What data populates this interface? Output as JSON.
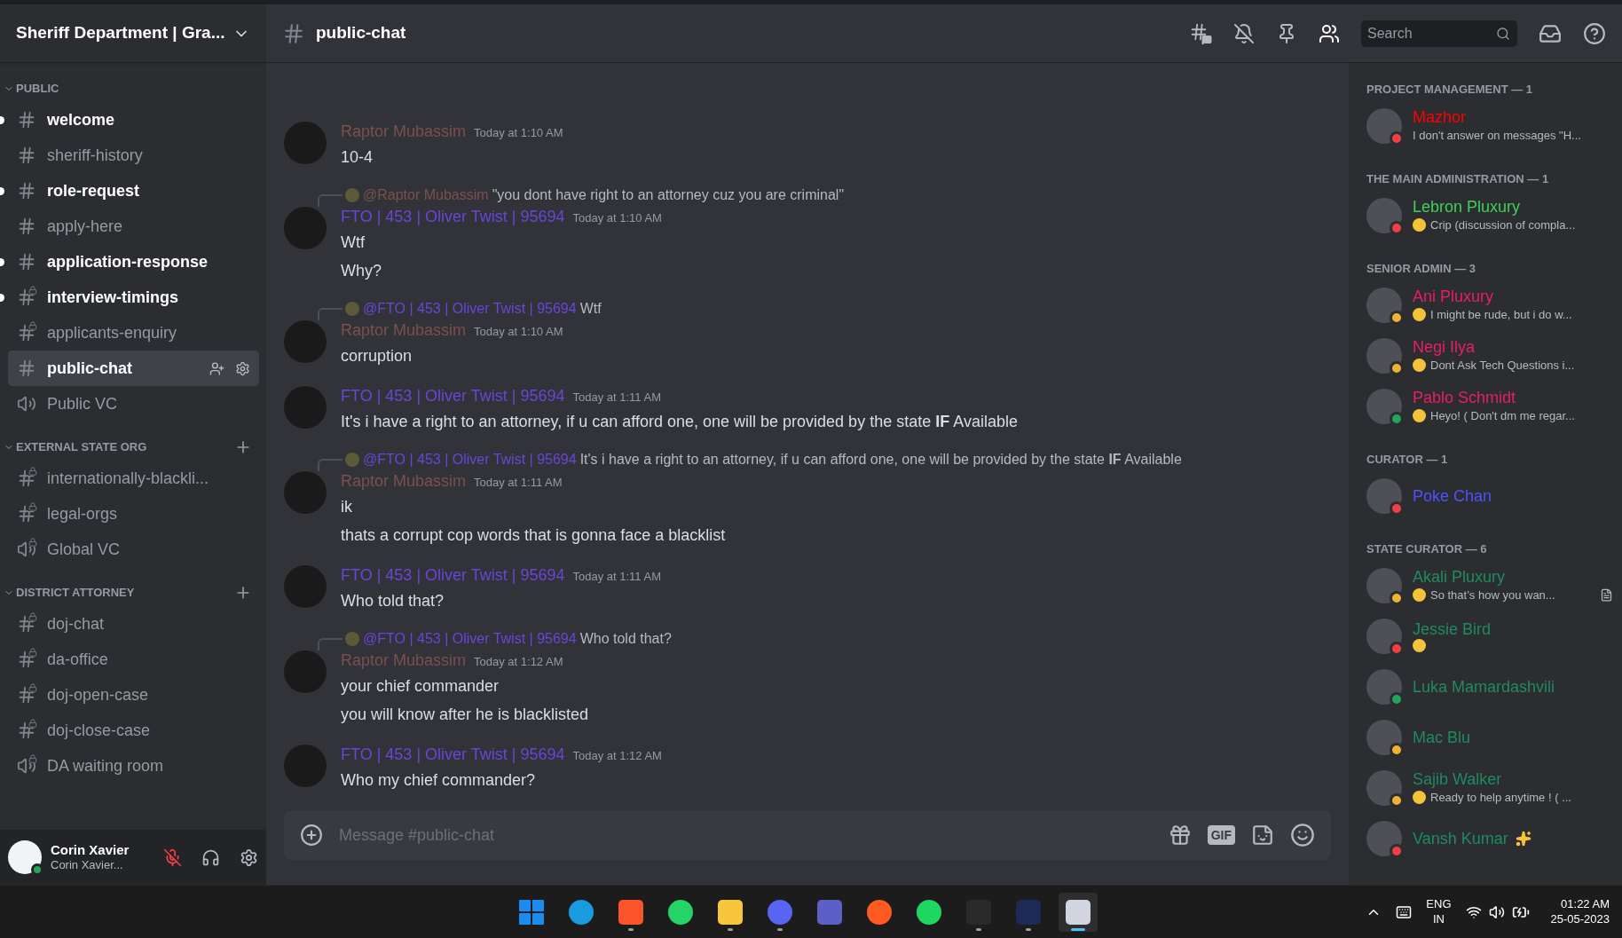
{
  "server": {
    "name": "Sheriff Department | Gra..."
  },
  "categories": [
    {
      "name": "PUBLIC",
      "add_button": false,
      "channels": [
        {
          "name": "welcome",
          "kind": "text",
          "unread": true,
          "selected": false
        },
        {
          "name": "sheriff-history",
          "kind": "text",
          "unread": false,
          "selected": false
        },
        {
          "name": "role-request",
          "kind": "text",
          "unread": true,
          "selected": false
        },
        {
          "name": "apply-here",
          "kind": "text",
          "unread": false,
          "selected": false
        },
        {
          "name": "application-response",
          "kind": "text",
          "unread": true,
          "selected": false
        },
        {
          "name": "interview-timings",
          "kind": "text_locked",
          "unread": true,
          "selected": false
        },
        {
          "name": "applicants-enquiry",
          "kind": "text_locked",
          "unread": false,
          "selected": false
        },
        {
          "name": "public-chat",
          "kind": "text",
          "unread": false,
          "selected": true
        },
        {
          "name": "Public VC",
          "kind": "voice",
          "unread": false,
          "selected": false
        }
      ]
    },
    {
      "name": "EXTERNAL STATE ORG",
      "add_button": true,
      "channels": [
        {
          "name": "internationally-blackli...",
          "kind": "text_locked",
          "unread": false,
          "selected": false
        },
        {
          "name": "legal-orgs",
          "kind": "text_locked",
          "unread": false,
          "selected": false
        },
        {
          "name": "Global VC",
          "kind": "voice_locked",
          "unread": false,
          "selected": false
        }
      ]
    },
    {
      "name": "DISTRICT ATTORNEY",
      "add_button": true,
      "channels": [
        {
          "name": "doj-chat",
          "kind": "text_locked",
          "unread": false,
          "selected": false
        },
        {
          "name": "da-office",
          "kind": "text_locked",
          "unread": false,
          "selected": false
        },
        {
          "name": "doj-open-case",
          "kind": "text_locked",
          "unread": false,
          "selected": false
        },
        {
          "name": "doj-close-case",
          "kind": "text_locked",
          "unread": false,
          "selected": false
        },
        {
          "name": "DA waiting room",
          "kind": "voice_locked",
          "unread": false,
          "selected": false
        }
      ]
    }
  ],
  "user_panel": {
    "name": "Corin Xavier",
    "subtext": "Corin Xavier...",
    "presence": {
      "kind": "online"
    },
    "mic_muted": true
  },
  "header": {
    "channel": "public-chat",
    "search_placeholder": "Search",
    "tools": [
      {
        "kind": "threads",
        "active": false
      },
      {
        "kind": "mute",
        "active": false
      },
      {
        "kind": "pins",
        "active": false
      },
      {
        "kind": "members",
        "active": true
      }
    ]
  },
  "messages": [
    {
      "author": "Raptor Mubassim",
      "color": "#7a5050",
      "time": "Today at 1:10 AM",
      "lines": [
        "10-4"
      ]
    },
    {
      "reply": {
        "author": "@Raptor Mubassim",
        "color": "#7a5050",
        "text": "\"you dont have right to an attorney cuz you are criminal\""
      },
      "author": "FTO | 453 | Oliver Twist | 95694",
      "color": "#6a45d8",
      "time": "Today at 1:10 AM",
      "lines": [
        "Wtf",
        "Why?"
      ]
    },
    {
      "reply": {
        "author": "@FTO | 453 | Oliver Twist | 95694",
        "color": "#6a45d8",
        "text": "Wtf"
      },
      "author": "Raptor Mubassim",
      "color": "#7a5050",
      "time": "Today at 1:10 AM",
      "lines": [
        "corruption"
      ]
    },
    {
      "author": "FTO | 453 | Oliver Twist | 95694",
      "color": "#6a45d8",
      "time": "Today at 1:11 AM",
      "lines": [
        "It's i have a right to an attorney, if u can afford one, one will be provided by the state **IF** Available"
      ]
    },
    {
      "reply": {
        "author": "@FTO | 453 | Oliver Twist | 95694",
        "color": "#6a45d8",
        "text": "It's i have a right to an attorney, if u can afford one, one will be provided by the state **IF** Available"
      },
      "author": "Raptor Mubassim",
      "color": "#7a5050",
      "time": "Today at 1:11 AM",
      "lines": [
        "ik",
        "thats a corrupt cop words that is gonna face a blacklist"
      ]
    },
    {
      "author": "FTO | 453 | Oliver Twist | 95694",
      "color": "#6a45d8",
      "time": "Today at 1:11 AM",
      "lines": [
        "Who told that?"
      ]
    },
    {
      "reply": {
        "author": "@FTO | 453 | Oliver Twist | 95694",
        "color": "#6a45d8",
        "text": "Who told that?"
      },
      "author": "Raptor Mubassim",
      "color": "#7a5050",
      "time": "Today at 1:12 AM",
      "lines": [
        "your chief commander",
        "you will know after he is blacklisted"
      ]
    },
    {
      "author": "FTO | 453 | Oliver Twist | 95694",
      "color": "#6a45d8",
      "time": "Today at 1:12 AM",
      "lines": [
        "Who my chief commander?"
      ]
    }
  ],
  "composer": {
    "placeholder": "Message #public-chat",
    "gif_label": "GIF"
  },
  "member_groups": [
    {
      "title": "PROJECT MANAGEMENT — 1",
      "members": [
        {
          "name": "Mazhor",
          "color": "#ff0000",
          "presence": {
            "kind": "dnd"
          },
          "emoji": false,
          "status": "I don't answer on messages \"H...",
          "activity": false,
          "sparkle": false
        }
      ]
    },
    {
      "title": "THE MAIN ADMINISTRATION — 1",
      "members": [
        {
          "name": "Lebron Pluxury",
          "color": "#3fd05a",
          "presence": {
            "kind": "dnd"
          },
          "emoji": true,
          "status": "Crip (discussion of compla...",
          "activity": false,
          "sparkle": false
        }
      ]
    },
    {
      "title": "SENIOR ADMIN — 3",
      "members": [
        {
          "name": "Ani Pluxury",
          "color": "#e91e63",
          "presence": {
            "kind": "idle"
          },
          "emoji": true,
          "status": "I might be rude, but i do w...",
          "activity": false,
          "sparkle": false
        },
        {
          "name": "Negi Ilya",
          "color": "#e91e63",
          "presence": {
            "kind": "idle"
          },
          "emoji": true,
          "status": "Dont Ask Tech Questions i...",
          "activity": false,
          "sparkle": false
        },
        {
          "name": "Pablo Schmidt",
          "color": "#e91e63",
          "presence": {
            "kind": "online"
          },
          "emoji": true,
          "status": "Heyo! ( Don't dm me regar...",
          "activity": false,
          "sparkle": false
        }
      ]
    },
    {
      "title": "CURATOR — 1",
      "members": [
        {
          "name": "Poke Chan",
          "color": "#5050ff",
          "presence": {
            "kind": "dnd"
          },
          "emoji": false,
          "activity": false,
          "sparkle": false
        }
      ]
    },
    {
      "title": "STATE CURATOR — 6",
      "members": [
        {
          "name": "Akali Pluxury",
          "color": "#1f8b5f",
          "presence": {
            "kind": "idle"
          },
          "emoji": true,
          "status": "So that’s how you wan...",
          "activity": true,
          "sparkle": false
        },
        {
          "name": "Jessie Bird",
          "color": "#1f8b5f",
          "presence": {
            "kind": "dnd"
          },
          "emoji": true,
          "activity": false,
          "sparkle": false
        },
        {
          "name": "Luka Mamardashvili",
          "color": "#1f8b5f",
          "presence": {
            "kind": "online"
          },
          "emoji": false,
          "activity": false,
          "sparkle": false
        },
        {
          "name": "Mac Blu",
          "color": "#1f8b5f",
          "presence": {
            "kind": "idle"
          },
          "emoji": false,
          "activity": false,
          "sparkle": false
        },
        {
          "name": "Sajib Walker",
          "color": "#1f8b5f",
          "presence": {
            "kind": "idle"
          },
          "emoji": true,
          "status": "Ready to help anytime ! ( ...",
          "activity": false,
          "sparkle": false
        },
        {
          "name": "Vansh Kumar",
          "color": "#1f8b5f",
          "presence": {
            "kind": "dnd"
          },
          "emoji": false,
          "activity": false,
          "sparkle": true
        }
      ]
    }
  ],
  "taskbar": {
    "apps": [
      {
        "kind": "start",
        "color": "#1a8cf0",
        "running": false,
        "active": false
      },
      {
        "kind": "circle",
        "color": "#1a9be0",
        "running": false,
        "active": false
      },
      {
        "kind": "square",
        "color": "#fb542b",
        "running": true,
        "active": false
      },
      {
        "kind": "circle",
        "color": "#25d366",
        "running": false,
        "active": false
      },
      {
        "kind": "square",
        "color": "#f8c63d",
        "running": true,
        "active": false
      },
      {
        "kind": "circle",
        "color": "#5865f2",
        "running": true,
        "active": false
      },
      {
        "kind": "square",
        "color": "#5b5fc7",
        "running": false,
        "active": false
      },
      {
        "kind": "circle",
        "color": "#ff5a1f",
        "running": false,
        "active": false
      },
      {
        "kind": "circle",
        "color": "#1ed760",
        "running": false,
        "active": false
      },
      {
        "kind": "square",
        "color": "#2a2a2a",
        "running": true,
        "active": false
      },
      {
        "kind": "square",
        "color": "#1d2a55",
        "running": true,
        "active": false
      },
      {
        "kind": "square",
        "color": "#d0d5e0",
        "running": true,
        "active": true
      }
    ],
    "lang": "ENG",
    "region": "IN",
    "time": "01:22 AM",
    "date": "25-05-2023"
  }
}
